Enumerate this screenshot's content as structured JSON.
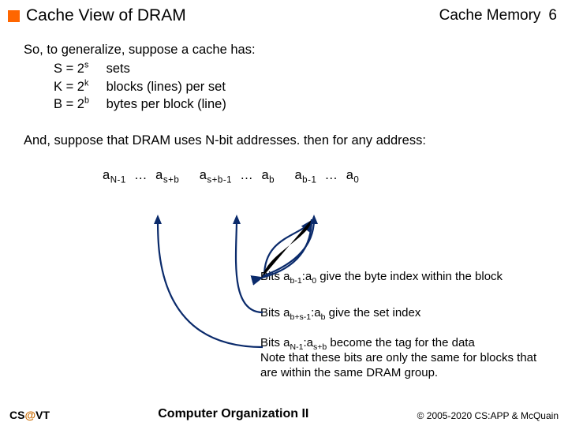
{
  "header": {
    "title": "Cache View of DRAM",
    "right": "Cache Memory",
    "page": "6"
  },
  "intro": "So, to generalize, suppose a cache has:",
  "specs": [
    {
      "lhs_sym": "S = 2",
      "lhs_sup": "s",
      "rhs": "sets"
    },
    {
      "lhs_sym": "K = 2",
      "lhs_sup": "k",
      "rhs": "blocks (lines) per set"
    },
    {
      "lhs_sym": "B = 2",
      "lhs_sup": "b",
      "rhs": "bytes per block (line)"
    }
  ],
  "para2": "And, suppose that DRAM uses N-bit addresses.  then for any address:",
  "addr": {
    "a0": "a",
    "s0": "N-1",
    "d1": "…",
    "a1": "a",
    "s1": "s+b",
    "a2": "a",
    "s2": "s+b-1",
    "d2": "…",
    "a3": "a",
    "s3": "b",
    "a4": "a",
    "s4": "b-1",
    "d3": "…",
    "a5": "a",
    "s5": "0"
  },
  "captions": {
    "c1_pre": "Bits a",
    "c1_sub1": "b-1",
    "c1_mid": ":a",
    "c1_sub2": "0",
    "c1_post": " give the byte index within the block",
    "c2_pre": "Bits a",
    "c2_sub1": "b+s-1",
    "c2_mid": ":a",
    "c2_sub2": "b",
    "c2_post": " give the set index",
    "c3_pre": "Bits a",
    "c3_sub1": "N-1",
    "c3_mid": ":a",
    "c3_sub2": "s+b",
    "c3_post": " become the tag for the data",
    "c3_line2": "Note that these bits are only the same for blocks that are within the same DRAM group."
  },
  "footer": {
    "left_a": "CS",
    "left_at": "@",
    "left_b": "VT",
    "center": "Computer Organization II",
    "right": "© 2005-2020 CS:APP & McQuain"
  }
}
